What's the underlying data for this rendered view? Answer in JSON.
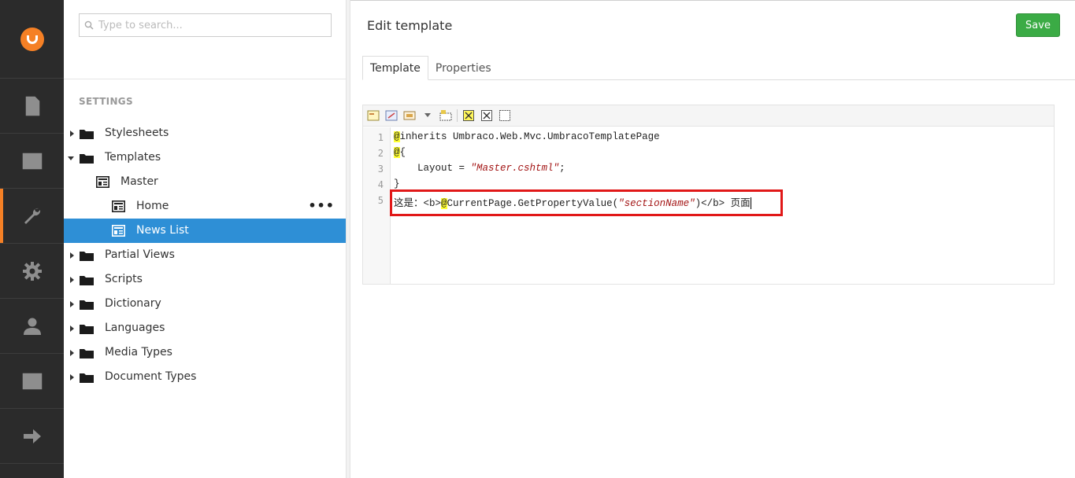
{
  "rail": {
    "items": [
      {
        "name": "content"
      },
      {
        "name": "media"
      },
      {
        "name": "settings",
        "active": true
      },
      {
        "name": "developer"
      },
      {
        "name": "users"
      },
      {
        "name": "members"
      },
      {
        "name": "redirect"
      }
    ]
  },
  "search": {
    "placeholder": "Type to search..."
  },
  "tree": {
    "section_title": "SETTINGS",
    "items": [
      {
        "label": "Stylesheets"
      },
      {
        "label": "Templates"
      },
      {
        "label": "Master"
      },
      {
        "label": "Home"
      },
      {
        "label": "News List"
      },
      {
        "label": "Partial Views"
      },
      {
        "label": "Scripts"
      },
      {
        "label": "Dictionary"
      },
      {
        "label": "Languages"
      },
      {
        "label": "Media Types"
      },
      {
        "label": "Document Types"
      }
    ],
    "actions_label": "•••"
  },
  "editor": {
    "title": "Edit template",
    "save_label": "Save",
    "tabs": [
      {
        "label": "Template"
      },
      {
        "label": "Properties"
      }
    ],
    "line_numbers": [
      "1",
      "2",
      "3",
      "4",
      "5"
    ],
    "code": {
      "l1_at": "@",
      "l1_rest": "inherits Umbraco.Web.Mvc.UmbracoTemplatePage",
      "l2_at": "@",
      "l2_rest": "{",
      "l3_pre": "    Layout = ",
      "l3_str": "\"Master.cshtml\"",
      "l3_post": ";",
      "l4": "}",
      "l5_pre": "这是：<b>",
      "l5_at": "@",
      "l5_mid": "CurrentPage.GetPropertyValue(",
      "l5_str": "\"sectionName\"",
      "l5_post": ")</b> 页面"
    }
  },
  "colors": {
    "rail_bg": "#2b2b2b",
    "accent": "#f58025",
    "selected_bg": "#2e8fd6",
    "save_bg": "#3bab45",
    "highlight_box": "#e11818"
  }
}
